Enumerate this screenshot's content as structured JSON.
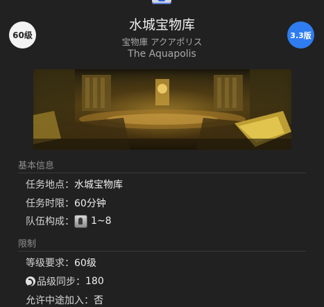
{
  "header": {
    "level_badge": "60级",
    "version_badge": "3.3版",
    "title": "水城宝物库",
    "subtitle_jp": "宝物庫 アクアポリス",
    "subtitle_en": "The Aquapolis"
  },
  "sections": {
    "basic_info": {
      "heading": "基本信息",
      "location_label": "任务地点：",
      "location_value": "水城宝物库",
      "time_label": "任务时限：",
      "time_value": "60分钟",
      "party_label": "队伍构成：",
      "party_value": "1~8"
    },
    "restrictions": {
      "heading": "限制",
      "level_label": "等级要求：",
      "level_value": "60级",
      "ilvl_label": "品级同步：",
      "ilvl_value": "180",
      "join_label": "允许中途加入：",
      "join_value": "否"
    }
  },
  "icons": {
    "top": "duty-type-icon",
    "party": "party-member-icon",
    "sync": "item-level-sync-icon"
  },
  "colors": {
    "background": "#212121",
    "version_badge": "#2f7cf0",
    "level_badge": "#f3f3f3"
  }
}
